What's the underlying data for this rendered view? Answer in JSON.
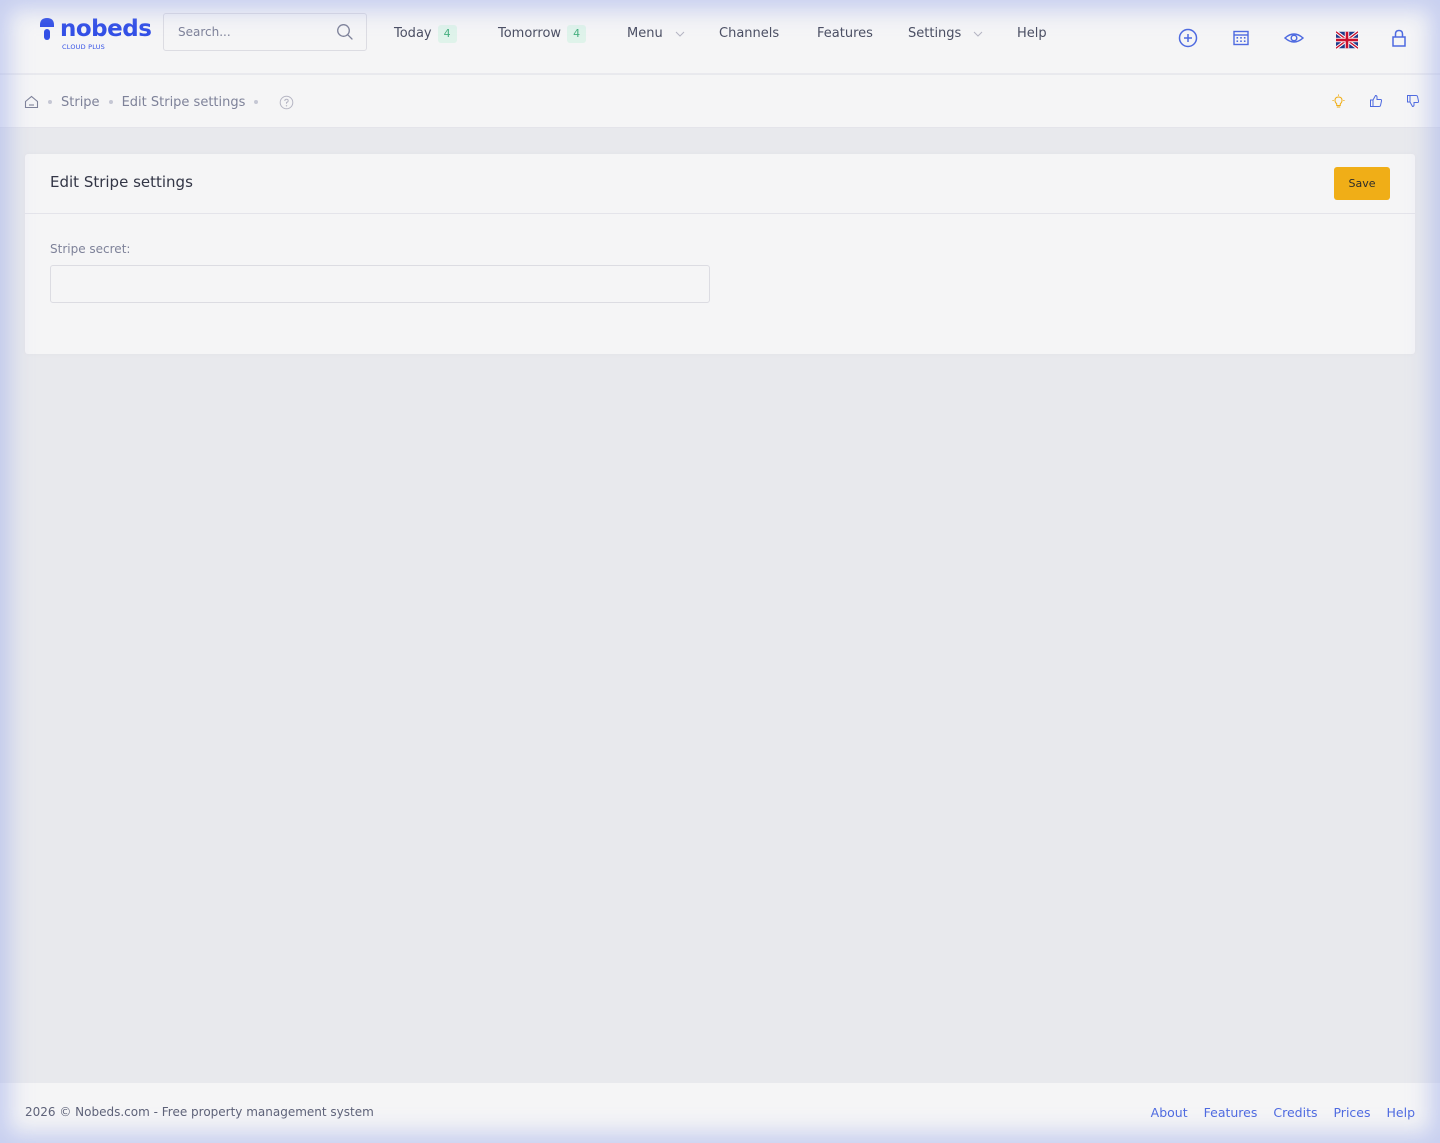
{
  "brand": {
    "name": "nobeds",
    "sub": "CLOUD PLUS",
    "color": "#3350e6"
  },
  "search": {
    "placeholder": "Search..."
  },
  "nav": {
    "today": {
      "label": "Today",
      "count": "4"
    },
    "tomorrow": {
      "label": "Tomorrow",
      "count": "4"
    },
    "menu": "Menu",
    "channels": "Channels",
    "features": "Features",
    "settings": "Settings",
    "help": "Help"
  },
  "header_icons": [
    "plus-circle-icon",
    "calendar-icon",
    "eye-icon",
    "uk-flag-icon",
    "lock-icon"
  ],
  "breadcrumb": {
    "items": [
      "Stripe",
      "Edit Stripe settings"
    ]
  },
  "subbar_icons": [
    "lightbulb-icon",
    "thumbs-up-icon",
    "thumbs-down-icon"
  ],
  "card": {
    "title": "Edit Stripe settings",
    "save_label": "Save",
    "save_color": "#f0ae17",
    "field_label": "Stripe secret:",
    "field_value": ""
  },
  "footer": {
    "copyright": "2026  © Nobeds.com - Free property management system",
    "links": [
      "About",
      "Features",
      "Credits",
      "Prices",
      "Help"
    ]
  }
}
